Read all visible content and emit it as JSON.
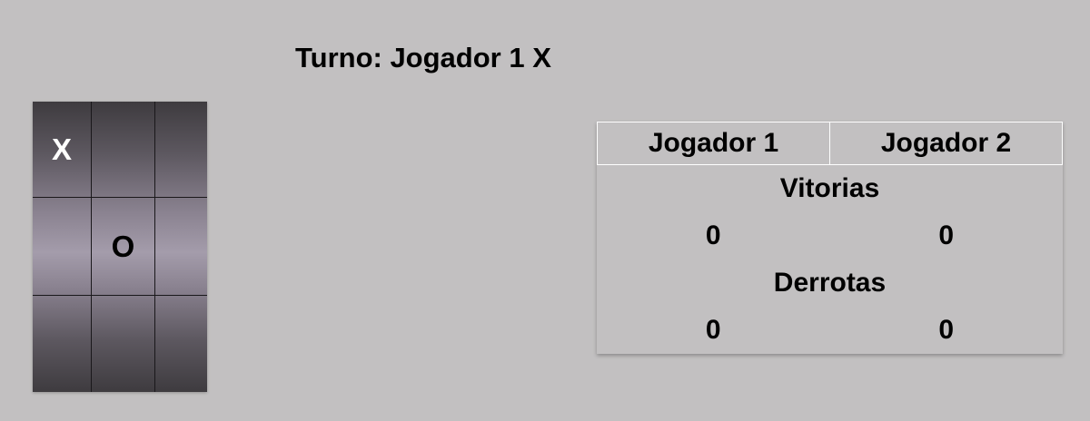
{
  "status": {
    "turn_text": "Turno: Jogador 1 X"
  },
  "board": {
    "cells": [
      "X",
      "",
      "",
      "",
      "O",
      "",
      "",
      "",
      ""
    ]
  },
  "scoreboard": {
    "players": [
      "Jogador 1",
      "Jogador 2"
    ],
    "wins_label": "Vitorias",
    "wins": [
      "0",
      "0"
    ],
    "losses_label": "Derrotas",
    "losses": [
      "0",
      "0"
    ]
  },
  "colors": {
    "background": "#c2c0c1",
    "x_mark": "#ffffff",
    "o_mark": "#000000"
  }
}
